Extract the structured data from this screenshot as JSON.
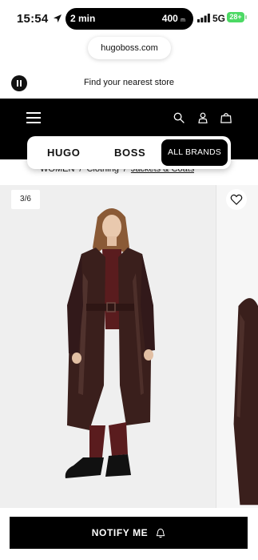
{
  "status_bar": {
    "time": "15:54",
    "activity_left": "2 min",
    "activity_right": "400",
    "activity_right_unit": "m",
    "network": "5G",
    "battery": "28+"
  },
  "browser": {
    "url": "hugoboss.com"
  },
  "store_bar": {
    "text": "Find your nearest store"
  },
  "header": {
    "icons": [
      "menu-icon",
      "search-icon",
      "account-icon",
      "bag-icon"
    ],
    "brands": [
      "HUGO",
      "BOSS",
      "ALL BRANDS"
    ],
    "active_brand": "ALL BRANDS"
  },
  "breadcrumb": {
    "items": [
      "WOMEN",
      "Clothing",
      "Jackets & Coats"
    ]
  },
  "gallery": {
    "counter": "3/6"
  },
  "cta": {
    "notify_label": "NOTIFY ME"
  },
  "colors": {
    "header_bg": "#000000",
    "coat": "#3a1f1c",
    "trousers": "#5a1c1e",
    "battery": "#4cd964"
  }
}
